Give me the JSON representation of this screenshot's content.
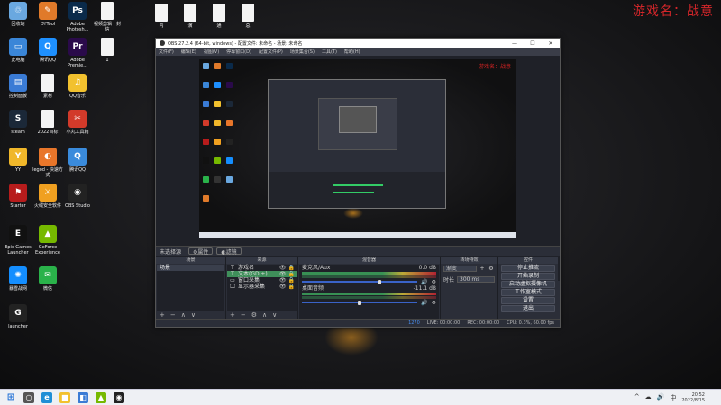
{
  "overlay_text": "游戏名：战意",
  "desktop_icons": [
    {
      "label": "回收站",
      "glyph": "♲",
      "color": "#6aa8e0",
      "icon": "recycle-bin-icon",
      "doc": false
    },
    {
      "label": "DYTool",
      "glyph": "✎",
      "color": "#e07a2a",
      "icon": "dytool-icon",
      "doc": false
    },
    {
      "label": "Adobe Photosh...",
      "glyph": "Ps",
      "color": "#0a2a4a",
      "icon": "photoshop-icon",
      "doc": false
    },
    {
      "label": "视频剪辑一封信",
      "glyph": "",
      "color": "#f4f4f4",
      "icon": "document-icon",
      "doc": true
    },
    {
      "label": "此电脑",
      "glyph": "▭",
      "color": "#3a86d8",
      "icon": "this-pc-icon",
      "doc": false
    },
    {
      "label": "腾讯QQ",
      "glyph": "Q",
      "color": "#1e90ff",
      "icon": "qq-icon",
      "doc": false
    },
    {
      "label": "Adobe Premie...",
      "glyph": "Pr",
      "color": "#2a0a4a",
      "icon": "premiere-icon",
      "doc": false
    },
    {
      "label": "1",
      "glyph": "",
      "color": "#f4f4f4",
      "icon": "document-icon",
      "doc": true
    },
    {
      "label": "控制面板",
      "glyph": "▤",
      "color": "#3a7bd5",
      "icon": "control-panel-icon",
      "doc": false
    },
    {
      "label": "素材",
      "glyph": "",
      "color": "#f4f4f4",
      "icon": "document-icon",
      "doc": true
    },
    {
      "label": "QQ音乐",
      "glyph": "♫",
      "color": "#f2c12e",
      "icon": "qq-music-icon",
      "doc": false
    },
    {
      "label": "steam",
      "glyph": "S",
      "color": "#1b2838",
      "icon": "steam-icon",
      "doc": false
    },
    {
      "label": "2022目标",
      "glyph": "",
      "color": "#f4f4f4",
      "icon": "document-icon",
      "doc": true
    },
    {
      "label": "小丸工具箱",
      "glyph": "✂",
      "color": "#d23a2a",
      "icon": "toolbox-icon",
      "doc": false
    },
    {
      "label": "YY",
      "glyph": "Y",
      "color": "#f0b72a",
      "icon": "yy-icon",
      "doc": false
    },
    {
      "label": "legod - 快速方式",
      "glyph": "◐",
      "color": "#e8762a",
      "icon": "legod-icon",
      "doc": false
    },
    {
      "label": "腾讯QQ",
      "glyph": "Q",
      "color": "#3a8bdc",
      "icon": "qq-icon",
      "doc": false
    },
    {
      "label": "Starter",
      "glyph": "⚑",
      "color": "#b71c1c",
      "icon": "starter-icon",
      "doc": false
    },
    {
      "label": "火绒安全软件",
      "glyph": "⚔",
      "color": "#f0a020",
      "icon": "huorong-icon",
      "doc": false
    },
    {
      "label": "OBS Studio",
      "glyph": "◉",
      "color": "#222222",
      "icon": "obs-icon",
      "doc": false
    },
    {
      "label": "Epic Games Launcher",
      "glyph": "E",
      "color": "#111111",
      "icon": "epic-icon",
      "doc": false
    },
    {
      "label": "GeForce Experience",
      "glyph": "▲",
      "color": "#76b900",
      "icon": "geforce-icon",
      "doc": false
    },
    {
      "label": "暴雪战网",
      "glyph": "✺",
      "color": "#148eff",
      "icon": "battlenet-icon",
      "doc": false
    },
    {
      "label": "微信",
      "glyph": "✉",
      "color": "#2ab24a",
      "icon": "wechat-icon",
      "doc": false
    },
    {
      "label": "launcher",
      "glyph": "G",
      "color": "#222222",
      "icon": "launcher-icon",
      "doc": false
    }
  ],
  "top_files": [
    {
      "label": "内"
    },
    {
      "label": "演"
    },
    {
      "label": "通"
    },
    {
      "label": "总"
    }
  ],
  "obs": {
    "title": "OBS 27.2.4 (64-bit, windows) - 配置文件: 未命名 - 场景: 未命名",
    "window_controls": {
      "minimize": "—",
      "maximize": "☐",
      "close": "✕"
    },
    "menu": [
      "文件(F)",
      "编辑(E)",
      "视图(V)",
      "停靠窗口(D)",
      "配置文件(P)",
      "场景集合(S)",
      "工具(T)",
      "帮助(H)"
    ],
    "scene_bar": {
      "current": "未选择源",
      "properties": "⚙属性",
      "filters": "◐滤镜"
    },
    "docks": {
      "scenes": {
        "title": "场景",
        "items": [
          "场景"
        ],
        "footer": [
          "+",
          "−",
          "∧",
          "∨"
        ]
      },
      "sources": {
        "title": "来源",
        "items": [
          {
            "icon": "T",
            "name": "游戏名",
            "selected": false
          },
          {
            "icon": "T",
            "name": "文本(GDI+)",
            "selected": true
          },
          {
            "icon": "▭",
            "name": "窗口采集",
            "selected": false
          },
          {
            "icon": "🖵",
            "name": "显示器采集",
            "selected": false
          }
        ],
        "eye": "👁",
        "lock": "🔒",
        "footer": [
          "+",
          "−",
          "⚙",
          "∧",
          "∨"
        ]
      },
      "mixer": {
        "title": "混音器",
        "channels": [
          {
            "name": "麦克风/Aux",
            "db": "0.0 dB",
            "level": 0.76
          },
          {
            "name": "桌面音频",
            "db": "-11.1 dB",
            "level": 0.56
          }
        ],
        "speaker": "🔊",
        "gear": "⚙"
      },
      "transitions": {
        "title": "转场特效",
        "transition": "渐变",
        "add": "+",
        "gear": "⚙",
        "duration_label": "时长",
        "duration": "300 ms"
      },
      "controls": {
        "title": "控件",
        "buttons": [
          "停止推流",
          "开始录制",
          "启动虚拟摄像机",
          "工作室模式",
          "设置",
          "退出"
        ]
      }
    },
    "status": {
      "live": "LIVE: 00:00:00",
      "rec": "REC: 00:00:00",
      "cpu": "CPU: 0.3%, 60.00 fps",
      "extra": "1270"
    }
  },
  "taskbar": {
    "start": "⊞",
    "apps": [
      {
        "icon": "search-icon",
        "glyph": "○",
        "color": "#555555"
      },
      {
        "icon": "edge-icon",
        "glyph": "e",
        "color": "#1f8fd6"
      },
      {
        "icon": "file-explorer-icon",
        "glyph": "▆",
        "color": "#f2c12e"
      },
      {
        "icon": "store-icon",
        "glyph": "◧",
        "color": "#3a7bd5"
      },
      {
        "icon": "geforce-icon",
        "glyph": "▲",
        "color": "#76b900"
      },
      {
        "icon": "obs-icon",
        "glyph": "◉",
        "color": "#222222"
      }
    ],
    "tray": [
      "^",
      "☁",
      "🔊",
      "中"
    ],
    "time": "20:52",
    "date": "2022/8/15"
  }
}
